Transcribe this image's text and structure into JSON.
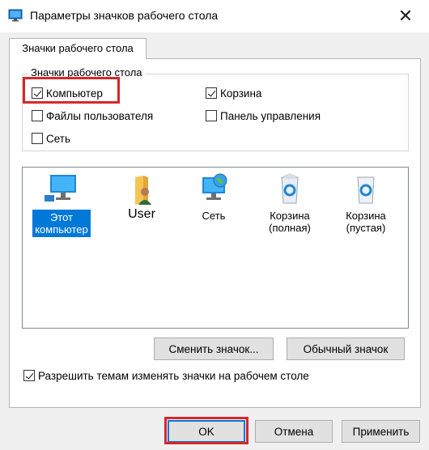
{
  "window": {
    "title": "Параметры значков рабочего стола",
    "close_glyph": "✕"
  },
  "tab": {
    "label": "Значки рабочего стола"
  },
  "group": {
    "title": "Значки рабочего стола",
    "checkboxes": [
      {
        "label": "Компьютер",
        "checked": true
      },
      {
        "label": "Корзина",
        "checked": true
      },
      {
        "label": "Файлы пользователя",
        "checked": false
      },
      {
        "label": "Панель управления",
        "checked": false
      },
      {
        "label": "Сеть",
        "checked": false
      }
    ]
  },
  "icons": [
    {
      "line1": "Этот",
      "line2": "компьютер",
      "selected": true,
      "icon": "monitor-icon"
    },
    {
      "line1": "User",
      "line2": "",
      "selected": false,
      "icon": "user-folder-icon"
    },
    {
      "line1": "Сеть",
      "line2": "",
      "selected": false,
      "icon": "network-icon"
    },
    {
      "line1": "Корзина",
      "line2": "(полная)",
      "selected": false,
      "icon": "recycle-bin-full-icon"
    },
    {
      "line1": "Корзина",
      "line2": "(пустая)",
      "selected": false,
      "icon": "recycle-bin-empty-icon"
    }
  ],
  "buttons": {
    "change_icon": "Сменить значок...",
    "default_icon": "Обычный значок",
    "ok": "OK",
    "cancel": "Отмена",
    "apply": "Применить"
  },
  "allow_themes": {
    "label": "Разрешить темам изменять значки на рабочем столе",
    "checked": true
  },
  "colors": {
    "selection": "#0078d7",
    "highlight_box": "#d9262c"
  }
}
